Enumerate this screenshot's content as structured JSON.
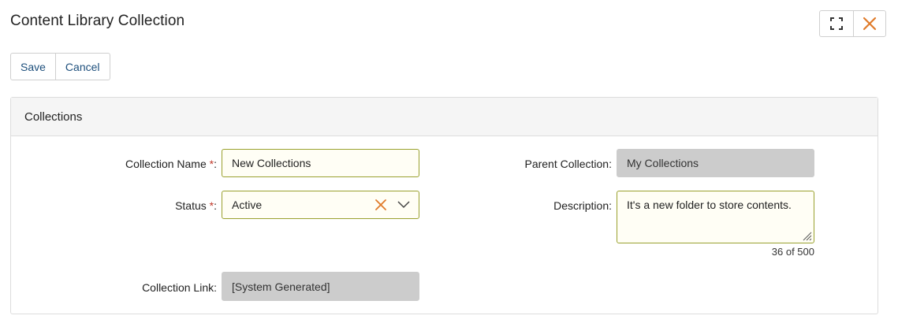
{
  "header": {
    "title": "Content Library Collection"
  },
  "window_controls": {
    "maximize_icon": "expand-icon",
    "close_icon": "close-icon",
    "close_color": "#e07b2a"
  },
  "toolbar": {
    "save_label": "Save",
    "cancel_label": "Cancel"
  },
  "panel": {
    "title": "Collections"
  },
  "form": {
    "collection_name": {
      "label": "Collection Name",
      "required_mark": "*",
      "suffix": ":",
      "value": "New Collections"
    },
    "status": {
      "label": "Status",
      "required_mark": "*",
      "suffix": ":",
      "value": "Active",
      "clear_icon": "clear-x-icon",
      "dropdown_icon": "chevron-down-icon"
    },
    "collection_link": {
      "label": "Collection Link:",
      "value": "[System Generated]"
    },
    "parent_collection": {
      "label": "Parent Collection:",
      "value": "My Collections"
    },
    "description": {
      "label": "Description:",
      "value": "It's a new folder to store contents.",
      "counter": "36 of 500"
    }
  },
  "colors": {
    "accent_link": "#1d4f7c",
    "field_border": "#9aa12f",
    "required": "#c0392b",
    "readonly_bg": "#cccccc"
  }
}
